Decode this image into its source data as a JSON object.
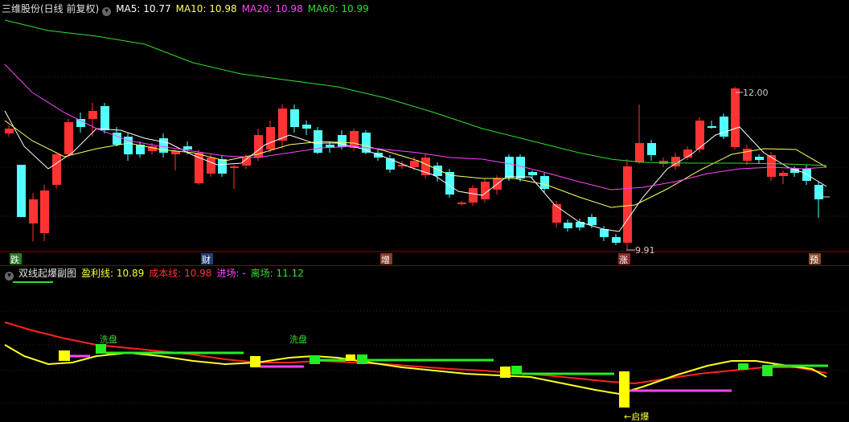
{
  "main": {
    "title": "三维股份(日线 前复权)",
    "ma": [
      {
        "label": "MA5: 10.77",
        "color": "#ffffff"
      },
      {
        "label": "MA10: 10.98",
        "color": "#ffff66"
      },
      {
        "label": "MA20: 10.98",
        "color": "#ff44ff"
      },
      {
        "label": "MA60: 10.99",
        "color": "#33dd33"
      }
    ],
    "high_label": "12.00",
    "low_label": "9.91",
    "markers": [
      {
        "text": "跌",
        "bg": "#2a7a2a",
        "color": "#ffffff"
      },
      {
        "text": "财",
        "bg": "#22407a",
        "color": "#ffffff"
      },
      {
        "text": "增",
        "bg": "#8a3a2a",
        "color": "#ffffff"
      },
      {
        "text": "涨",
        "bg": "#8a2a2a",
        "color": "#ffffff"
      },
      {
        "text": "预",
        "bg": "#8a4a2a",
        "color": "#ffffff"
      }
    ]
  },
  "sub": {
    "title": "双线起爆副图",
    "profit": "盈利线: 10.89",
    "cost": "成本线: 10.98",
    "entry": "进场: -",
    "exit": "离场: 11.12",
    "annotations": [
      {
        "text": "洗盘",
        "color": "#33dd33"
      },
      {
        "text": "洗盘",
        "color": "#33dd33"
      },
      {
        "text": "←启爆",
        "color": "#ffff33"
      }
    ]
  },
  "colors": {
    "up": "#ff3333",
    "down": "#54ffff",
    "ma5": "#ffffff",
    "ma10": "#ffff66",
    "ma20": "#ff44ff",
    "ma60": "#33dd33"
  }
}
